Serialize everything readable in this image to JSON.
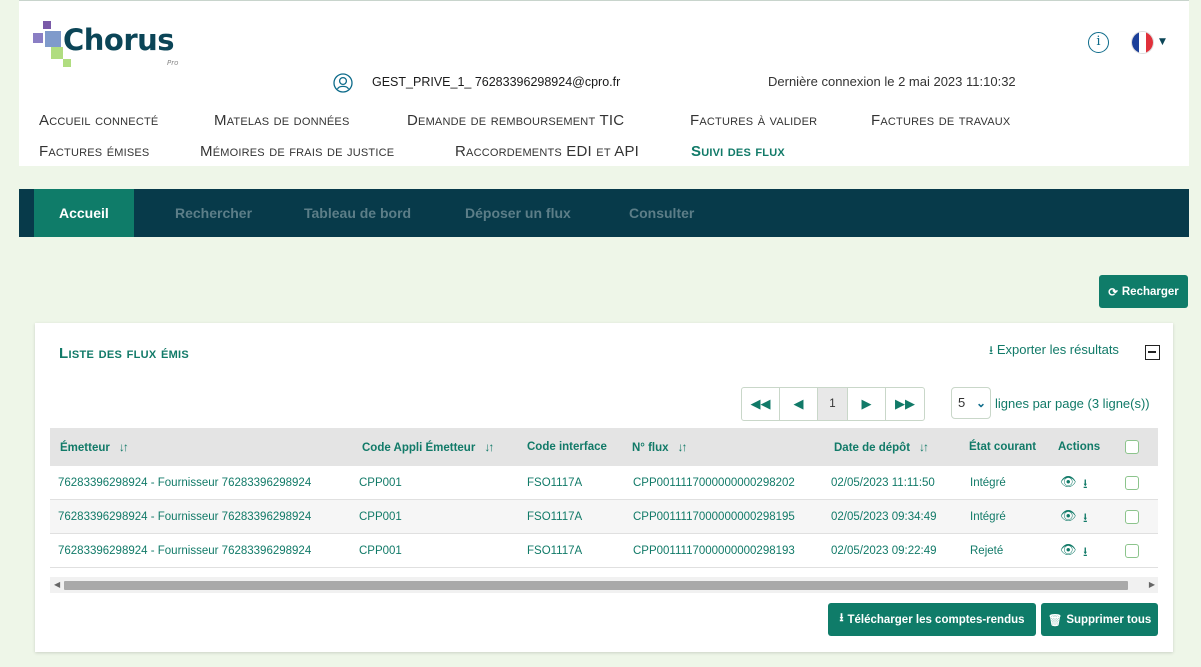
{
  "brand": {
    "name": "Chorus",
    "sub": "Pro"
  },
  "header": {
    "user_email": "GEST_PRIVE_1_ 76283396298924@cpro.fr",
    "last_login": "Dernière connexion le 2 mai 2023 11:10:32",
    "info_label": "i"
  },
  "nav": {
    "row1": [
      "Accueil connecté",
      "Matelas de données",
      "Demande de remboursement TIC",
      "Factures à valider",
      "Factures de travaux"
    ],
    "row2": [
      "Factures émises",
      "Mémoires de frais de justice",
      "Raccordements EDI et API",
      "Suivi des flux"
    ],
    "active": "Suivi des flux"
  },
  "tabs": [
    "Accueil",
    "Rechercher",
    "Tableau de bord",
    "Déposer un flux",
    "Consulter"
  ],
  "reload_label": "Recharger",
  "panel": {
    "title": "Liste des flux émis",
    "export_label": "Exporter les résultats",
    "page_current": "1",
    "per_page": "5",
    "per_page_label": "lignes par page (3 ligne(s))"
  },
  "table": {
    "headers": [
      "Émetteur",
      "Code Appli Émetteur",
      "Code interface",
      "N° flux",
      "Date de dépôt",
      "État courant",
      "Actions"
    ],
    "rows": [
      {
        "emetteur": "76283396298924 - Fournisseur 76283396298924",
        "code_appli": "CPP001",
        "code_interface": "FSO1117A",
        "num_flux": "CPP0011117000000000298202",
        "date": "02/05/2023 11:11:50",
        "etat": "Intégré"
      },
      {
        "emetteur": "76283396298924 - Fournisseur 76283396298924",
        "code_appli": "CPP001",
        "code_interface": "FSO1117A",
        "num_flux": "CPP0011117000000000298195",
        "date": "02/05/2023 09:34:49",
        "etat": "Intégré"
      },
      {
        "emetteur": "76283396298924 - Fournisseur 76283396298924",
        "code_appli": "CPP001",
        "code_interface": "FSO1117A",
        "num_flux": "CPP0011117000000000298193",
        "date": "02/05/2023 09:22:49",
        "etat": "Rejeté"
      }
    ]
  },
  "footer_buttons": {
    "download": "Télécharger les comptes-rendus",
    "delete": "Supprimer tous"
  },
  "colors": {
    "accent": "#0f7c69",
    "navbar": "#073a4a",
    "background": "#eef6e8"
  }
}
